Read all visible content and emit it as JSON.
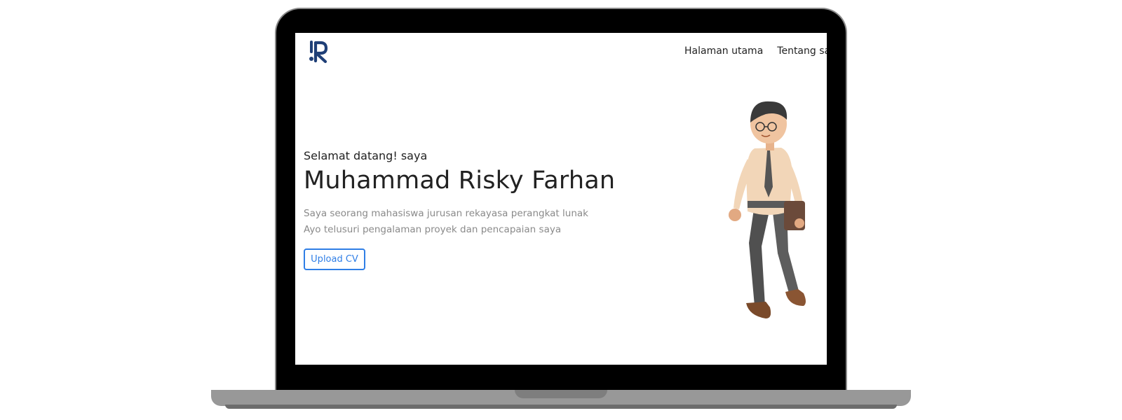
{
  "nav": {
    "items": [
      {
        "label": "Halaman utama"
      },
      {
        "label": "Tentang saya"
      }
    ]
  },
  "hero": {
    "greeting": "Selamat datang! saya",
    "name": "Muhammad Risky Farhan",
    "description_lines": [
      "Saya seorang mahasiswa jurusan rekayasa perangkat lunak",
      "Ayo telusuri pengalaman proyek dan pencapaian saya"
    ],
    "cta_label": "Upload CV"
  },
  "colors": {
    "accent": "#2f7ee6",
    "logo": "#1f3f77",
    "text": "#222222",
    "muted": "#8a8a8a"
  }
}
